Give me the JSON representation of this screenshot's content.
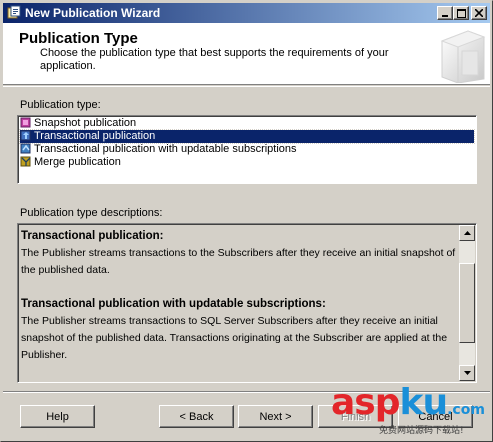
{
  "window": {
    "title": "New Publication Wizard"
  },
  "header": {
    "title": "Publication Type",
    "subtitle": "Choose the publication type that best supports the requirements of your application."
  },
  "publication_type": {
    "label": "Publication type:",
    "items": [
      {
        "label": "Snapshot publication",
        "icon": "snapshot-publication-icon",
        "selected": false
      },
      {
        "label": "Transactional publication",
        "icon": "transactional-publication-icon",
        "selected": true
      },
      {
        "label": "Transactional publication with updatable subscriptions",
        "icon": "transactional-updatable-publication-icon",
        "selected": false
      },
      {
        "label": "Merge publication",
        "icon": "merge-publication-icon",
        "selected": false
      }
    ]
  },
  "descriptions": {
    "label": "Publication type descriptions:",
    "blocks": [
      {
        "heading": "Transactional publication:",
        "text": "The Publisher streams transactions to the Subscribers after they receive an initial snapshot of the published data."
      },
      {
        "heading": "Transactional publication with updatable subscriptions:",
        "text": "The Publisher streams transactions to SQL Server Subscribers after they receive an initial snapshot of the published data. Transactions originating at the Subscriber are applied at the Publisher."
      }
    ]
  },
  "buttons": {
    "help": "Help",
    "back": "< Back",
    "next": "Next >",
    "finish": "Finish",
    "cancel": "Cancel"
  },
  "watermark": {
    "asp": "asp",
    "ku": "ku",
    "com": ".com",
    "sub": "免费网站源码下载站!"
  },
  "colors": {
    "selection": "#0a246a",
    "title_gradient_start": "#0a246a",
    "title_gradient_end": "#a6caf0",
    "dialog_face": "#d4d0c8"
  }
}
